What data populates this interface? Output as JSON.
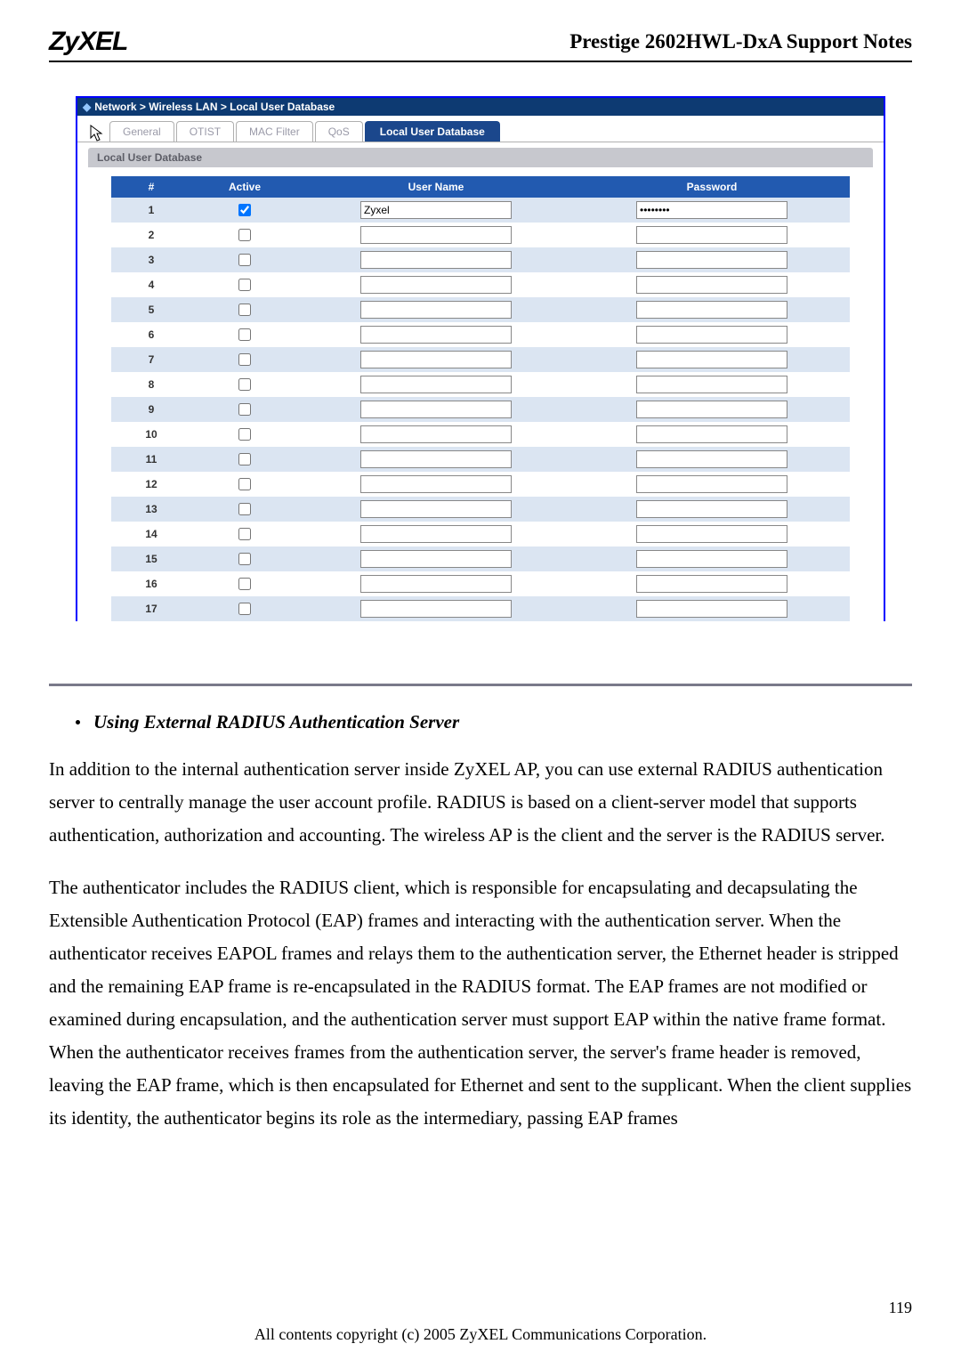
{
  "header": {
    "logo": "ZyXEL",
    "title": "Prestige 2602HWL-DxA Support Notes"
  },
  "breadcrumb": "Network > Wireless LAN > Local User Database",
  "tabs": {
    "general": "General",
    "otist": "OTIST",
    "mac": "MAC Filter",
    "qos": "QoS",
    "local": "Local User Database"
  },
  "section_label": "Local User Database",
  "table": {
    "headers": {
      "num": "#",
      "active": "Active",
      "user": "User Name",
      "pass": "Password"
    },
    "rows": [
      {
        "n": "1",
        "active": true,
        "user": "Zyxel",
        "pass": "••••••••"
      },
      {
        "n": "2",
        "active": false,
        "user": "",
        "pass": ""
      },
      {
        "n": "3",
        "active": false,
        "user": "",
        "pass": ""
      },
      {
        "n": "4",
        "active": false,
        "user": "",
        "pass": ""
      },
      {
        "n": "5",
        "active": false,
        "user": "",
        "pass": ""
      },
      {
        "n": "6",
        "active": false,
        "user": "",
        "pass": ""
      },
      {
        "n": "7",
        "active": false,
        "user": "",
        "pass": ""
      },
      {
        "n": "8",
        "active": false,
        "user": "",
        "pass": ""
      },
      {
        "n": "9",
        "active": false,
        "user": "",
        "pass": ""
      },
      {
        "n": "10",
        "active": false,
        "user": "",
        "pass": ""
      },
      {
        "n": "11",
        "active": false,
        "user": "",
        "pass": ""
      },
      {
        "n": "12",
        "active": false,
        "user": "",
        "pass": ""
      },
      {
        "n": "13",
        "active": false,
        "user": "",
        "pass": ""
      },
      {
        "n": "14",
        "active": false,
        "user": "",
        "pass": ""
      },
      {
        "n": "15",
        "active": false,
        "user": "",
        "pass": ""
      },
      {
        "n": "16",
        "active": false,
        "user": "",
        "pass": ""
      },
      {
        "n": "17",
        "active": false,
        "user": "",
        "pass": ""
      }
    ]
  },
  "body": {
    "heading": "Using External RADIUS Authentication Server",
    "p1": "In addition to the internal authentication server inside ZyXEL AP, you can use external RADIUS authentication server to centrally manage the user account profile. RADIUS is based on a client-server model that supports authentication, authorization and accounting. The wireless AP is the client and the server is the RADIUS server.",
    "p2": "The authenticator includes the RADIUS client, which is responsible for encapsulating and decapsulating the Extensible Authentication Protocol (EAP) frames and interacting with the authentication server. When the authenticator receives EAPOL frames and relays them to the authentication server, the Ethernet header is stripped and the remaining EAP frame is re-encapsulated in the RADIUS format. The EAP frames are not modified or examined during encapsulation, and the authentication server must support EAP within the native frame format. When the authenticator receives frames from the authentication server, the server's frame header is removed, leaving the EAP frame, which is then encapsulated for Ethernet and sent to the supplicant. When the client supplies its identity, the authenticator begins its role as the intermediary, passing EAP frames"
  },
  "page_number": "119",
  "footer": "All contents copyright (c) 2005 ZyXEL Communications Corporation."
}
